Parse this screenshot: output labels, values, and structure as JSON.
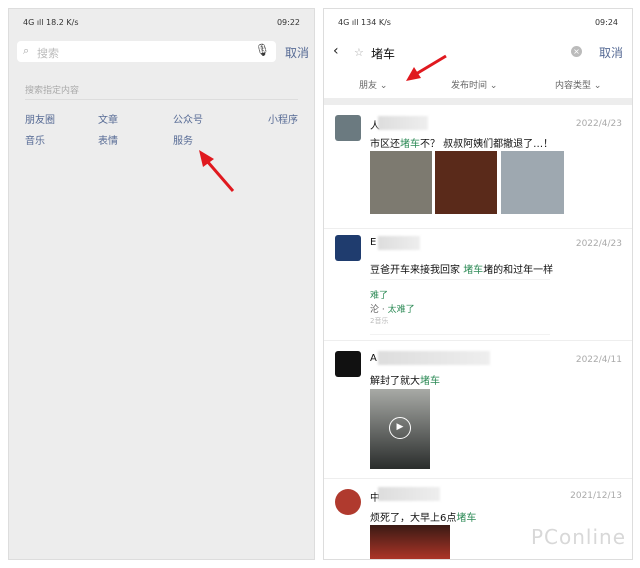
{
  "left": {
    "status": {
      "left": "4G ıll 18.2 K/s",
      "time": "09:22",
      "battery": "100"
    },
    "search": {
      "placeholder": "搜索",
      "cancel": "取消"
    },
    "hint": "搜索指定内容",
    "categories": [
      "朋友圈",
      "文章",
      "公众号",
      "小程序",
      "音乐",
      "表情",
      "服务"
    ]
  },
  "right": {
    "status": {
      "left": "4G ıll 134 K/s",
      "time": "09:24",
      "battery": "100"
    },
    "search": {
      "query": "堵车",
      "cancel": "取消"
    },
    "filters": [
      "朋友",
      "发布时间",
      "内容类型"
    ],
    "posts": [
      {
        "name": "人",
        "date": "2022/4/23",
        "pre": "市区还",
        "kw": "堵车",
        "post": "不？ 叔叔阿姨们都撤退了…！"
      },
      {
        "name": "E",
        "date": "2022/4/23",
        "pre": "豆爸开车来接我回家 ",
        "kw": "堵车",
        "post": "堵的和过年一样",
        "music": {
          "title": "难了",
          "artist_pre": "沦 · ",
          "artist": "太难了",
          "source": "2音乐"
        }
      },
      {
        "name": "A",
        "date": "2022/4/11",
        "pre": "解封了就大",
        "kw": "堵车",
        "post": ""
      },
      {
        "name": "中",
        "date": "2021/12/13",
        "pre": "烦死了，大早上6点",
        "kw": "堵车",
        "post": ""
      }
    ]
  },
  "watermark": "PConline",
  "colors": {
    "accent": "#576b95",
    "keyword": "#2e8b57",
    "arrow": "#e0191f"
  }
}
